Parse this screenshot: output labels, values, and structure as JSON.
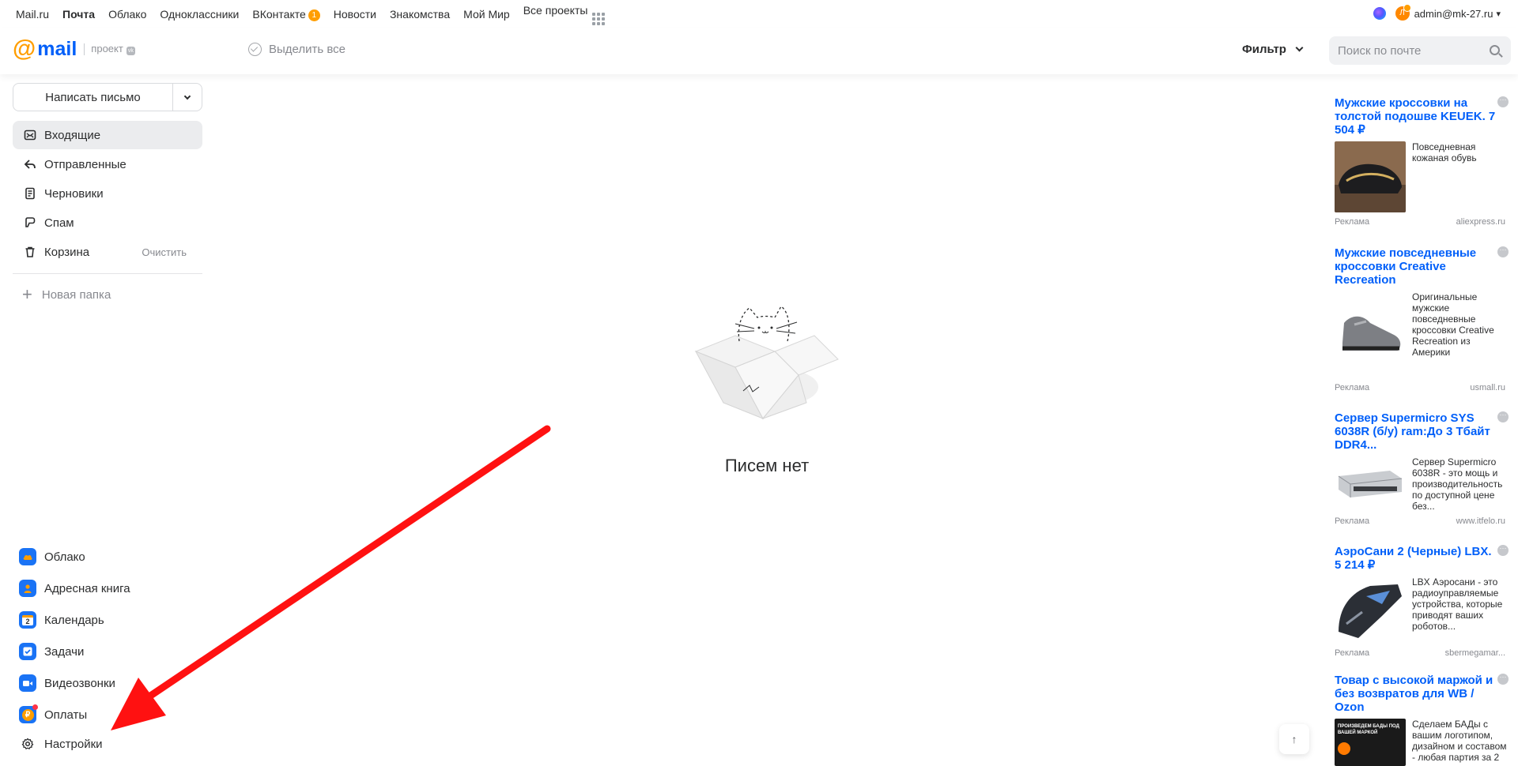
{
  "portal": {
    "links": [
      "Mail.ru",
      "Почта",
      "Облако",
      "Одноклассники",
      "ВКонтакте",
      "Новости",
      "Знакомства",
      "Мой Мир",
      "Все проекты"
    ],
    "vk_badge": "1",
    "active_link": "Почта",
    "avatar_letter": "Л",
    "user_email": "admin@mk-27.ru",
    "user_caret": "▾"
  },
  "header": {
    "logo_at": "@",
    "logo_text": "mail",
    "logo_project": "проект",
    "logo_vk": "vk",
    "select_all": "Выделить все",
    "filter": "Фильтр",
    "search_placeholder": "Поиск по почте"
  },
  "sidebar": {
    "compose": "Написать письмо",
    "folders": [
      {
        "label": "Входящие",
        "icon": "inbox-icon",
        "active": true
      },
      {
        "label": "Отправленные",
        "icon": "sent-icon"
      },
      {
        "label": "Черновики",
        "icon": "drafts-icon"
      },
      {
        "label": "Спам",
        "icon": "spam-icon"
      },
      {
        "label": "Корзина",
        "icon": "trash-icon",
        "extra": "Очистить"
      }
    ],
    "new_folder": "Новая папка",
    "apps": [
      {
        "label": "Облако",
        "icon": "cloud-icon",
        "color": "#005ff9"
      },
      {
        "label": "Адресная книга",
        "icon": "contacts-icon",
        "color": "#005ff9"
      },
      {
        "label": "Календарь",
        "icon": "calendar-icon",
        "color": "#005ff9",
        "day": "2"
      },
      {
        "label": "Задачи",
        "icon": "tasks-icon",
        "color": "#005ff9"
      },
      {
        "label": "Видеозвонки",
        "icon": "video-call-icon",
        "color": "#005ff9"
      },
      {
        "label": "Оплаты",
        "icon": "payments-icon",
        "color": "#005ff9",
        "glyph": "₽"
      },
      {
        "label": "Настройки",
        "icon": "gear-icon"
      }
    ]
  },
  "main": {
    "empty_text": "Писем нет"
  },
  "ads": [
    {
      "title": "Мужские кроссовки на толстой подошве KEUEK. 7 504 ₽",
      "text": "Повседневная кожаная обувь",
      "label": "Реклама",
      "domain": "aliexpress.ru"
    },
    {
      "title": "Мужские повседневные кроссовки Creative Recreation",
      "text": "Оригинальные мужские повседневные кроссовки Creative Recreation из Америки",
      "label": "Реклама",
      "domain": "usmall.ru"
    },
    {
      "title": "Сервер Supermicro SYS 6038R (б/у) ram:До 3 Тбайт DDR4...",
      "text": "Сервер Supermicro 6038R - это мощь и производительность по доступной цене без...",
      "label": "Реклама",
      "domain": "www.itfelo.ru"
    },
    {
      "title": "АэроСани 2 (Черные) LBX. 5 214 ₽",
      "text": "LBX Аэросани - это радиоуправляемые устройства, которые приводят ваших роботов...",
      "label": "Реклама",
      "domain": "sbermegamar..."
    },
    {
      "title": "Товар с высокой маржой и без возвратов для WB / Ozon",
      "text": "Сделаем БАДы с вашим логотипом, дизайном и составом - любая партия за 2",
      "img_text": "ПРОИЗВЕДЕМ БАДЫ ПОД ВАШЕЙ МАРКОЙ",
      "label": "",
      "domain": ""
    }
  ],
  "scroll_top": "↑"
}
